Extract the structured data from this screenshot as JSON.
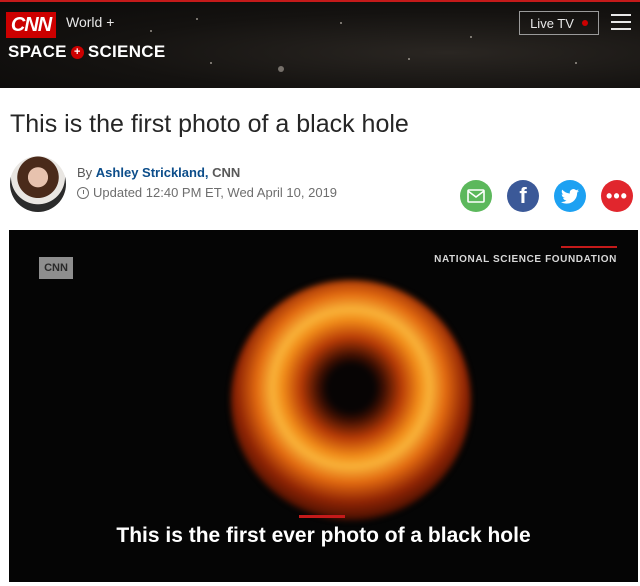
{
  "header": {
    "logo_text": "CNN",
    "nav_link": "World +",
    "section_name_left": "SPACE",
    "section_connector": "+",
    "section_name_right": "SCIENCE",
    "live_tv_label": "Live TV",
    "colors": {
      "brand_red": "#cc0000",
      "header_bg": "#141210"
    }
  },
  "article": {
    "headline": "This is the first photo of a black hole",
    "byline_prefix": "By",
    "author": "Ashley Strickland,",
    "outlet": "CNN",
    "updated": "Updated 12:40 PM ET, Wed April 10, 2019"
  },
  "share_icons": [
    "email-icon",
    "facebook-icon",
    "twitter-icon",
    "more-icon"
  ],
  "share": {
    "facebook_glyph": "f",
    "more_glyph": "•••"
  },
  "media": {
    "watermark": "CNN",
    "credit": "NATIONAL SCIENCE FOUNDATION",
    "caption": "This is the first ever photo of a black hole"
  }
}
